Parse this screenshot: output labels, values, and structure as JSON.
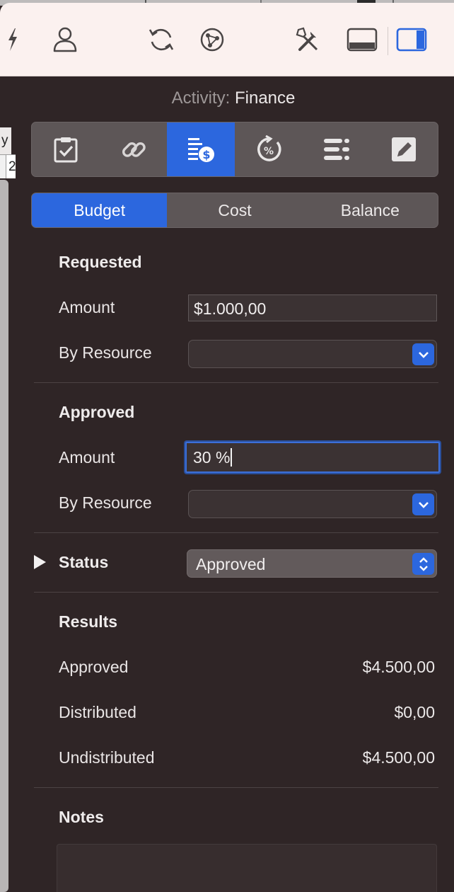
{
  "left_table": {
    "header_fragment": "y",
    "cell_fragment": "2"
  },
  "toolbar": {
    "icons": [
      "flash-icon",
      "person-icon",
      "refresh-icon",
      "network-icon",
      "tools-icon",
      "bottom-panel-icon",
      "right-panel-icon"
    ]
  },
  "inspector": {
    "title_key": "Activity:",
    "title_value": "Finance",
    "tabs": [
      {
        "icon": "clipboard-check-icon",
        "active": false
      },
      {
        "icon": "link-icon",
        "active": false
      },
      {
        "icon": "finance-list-icon",
        "active": true
      },
      {
        "icon": "percent-progress-icon",
        "active": false
      },
      {
        "icon": "list-icon",
        "active": false
      },
      {
        "icon": "pencil-icon",
        "active": false
      }
    ],
    "segments": [
      "Budget",
      "Cost",
      "Balance"
    ],
    "active_segment": "Budget",
    "requested": {
      "heading": "Requested",
      "amount_label": "Amount",
      "amount_value": "$1.000,00",
      "resource_label": "By Resource",
      "resource_value": ""
    },
    "approved": {
      "heading": "Approved",
      "amount_label": "Amount",
      "amount_value": "30 %",
      "resource_label": "By Resource",
      "resource_value": ""
    },
    "status": {
      "label": "Status",
      "value": "Approved"
    },
    "results": {
      "heading": "Results",
      "rows": [
        {
          "label": "Approved",
          "value": "$4.500,00"
        },
        {
          "label": "Distributed",
          "value": "$0,00"
        },
        {
          "label": "Undistributed",
          "value": "$4.500,00"
        }
      ]
    },
    "notes": {
      "heading": "Notes",
      "text": ""
    }
  },
  "colors": {
    "accent": "#2c67de",
    "panel_bg": "#2f2526",
    "toolbar_bg": "#fbf1ef"
  }
}
